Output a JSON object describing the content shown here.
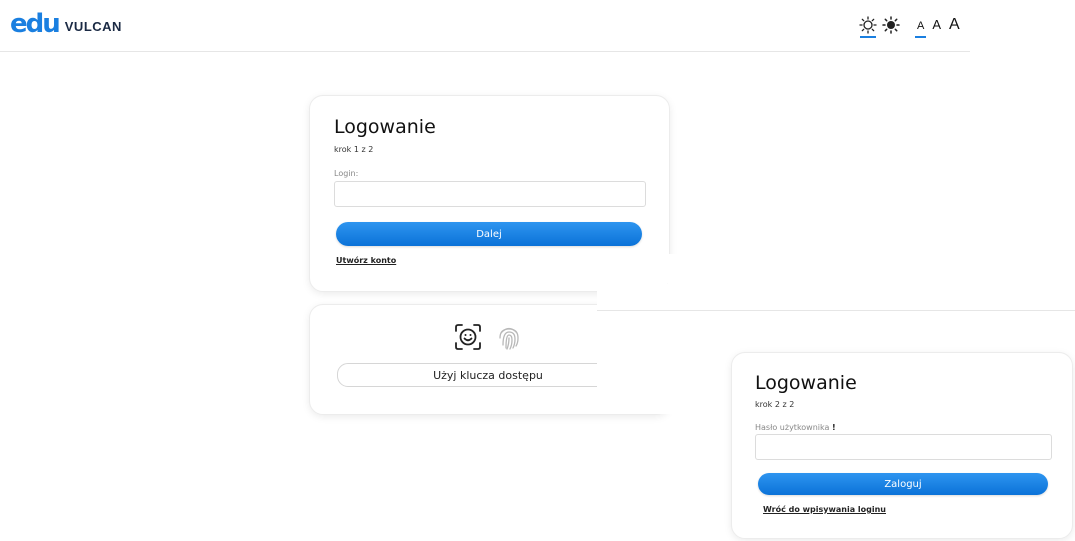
{
  "header": {
    "logo_mark": "edu",
    "logo_text": "VULCAN",
    "contrast_icons": [
      "sun-outline-icon",
      "sun-filled-icon"
    ],
    "font_sizes": [
      "A",
      "A",
      "A"
    ]
  },
  "login_step1": {
    "title": "Logowanie",
    "step": "krok 1 z 2",
    "login_label": "Login:",
    "login_value": "",
    "submit_label": "Dalej",
    "create_account_link": "Utwórz konto"
  },
  "passkey": {
    "icons": [
      "face-id-icon",
      "fingerprint-icon"
    ],
    "button_label": "Użyj klucza dostępu"
  },
  "login_step2": {
    "title": "Logowanie",
    "step": "krok 2 z 2",
    "password_label": "Hasło użytkownika",
    "required_mark": "!",
    "password_value": "",
    "submit_label": "Zaloguj",
    "back_link": "Wróć do wpisywania loginu"
  },
  "colors": {
    "accent": "#1a7fe0",
    "button_gradient_top": "#2e95f0",
    "button_gradient_bottom": "#0b72d8"
  }
}
